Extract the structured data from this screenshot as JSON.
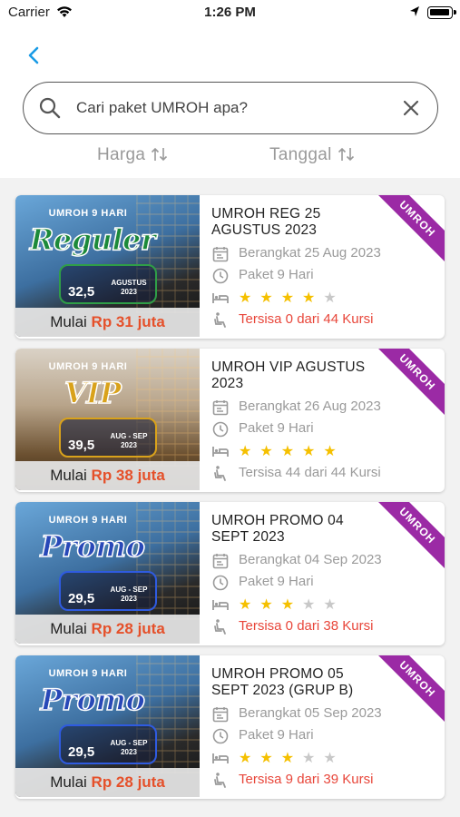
{
  "status_bar": {
    "carrier": "Carrier",
    "time": "1:26 PM"
  },
  "search": {
    "placeholder": "Cari paket UMROH apa?",
    "value": ""
  },
  "sort": {
    "price_label": "Harga",
    "date_label": "Tanggal"
  },
  "colors": {
    "accent": "#1a9be6",
    "ribbon": "#9b2aa5",
    "price": "#e5502a",
    "star": "#f5c000",
    "seats_warning": "#e8463a"
  },
  "packages": [
    {
      "thumb": {
        "tag": "UMROH 9 HARI",
        "script": "Reguler",
        "script_color": "#1c8a3a",
        "pill_color": "#2f9e47",
        "price": "32,5",
        "month": "AGUSTUS 2023",
        "bg": "linear-gradient(160deg,#6aa7d9 0%,#3d6fa0 45%,#2a2a2a 70%,#111 100%)"
      },
      "price_prefix": "Mulai",
      "price": "Rp 31 juta",
      "title": "UMROH REG 25 AGUSTUS 2023",
      "departure": "Berangkat 25 Aug 2023",
      "duration": "Paket 9 Hari",
      "rating": 4,
      "seats": "Tersisa 0 dari 44 Kursi",
      "seats_warning": true,
      "ribbon": "UMROH"
    },
    {
      "thumb": {
        "tag": "UMROH 9 HARI",
        "script": "VIP",
        "script_color": "#d9a21b",
        "pill_color": "#d9a21b",
        "price": "39,5",
        "month": "AUG - SEP 2023",
        "bg": "linear-gradient(180deg,#dad2c6 0%,#b8a48a 40%,#6b5030 75%,#3a2a18 100%)"
      },
      "price_prefix": "Mulai",
      "price": "Rp 38 juta",
      "title": "UMROH VIP AGUSTUS 2023",
      "departure": "Berangkat 26 Aug 2023",
      "duration": "Paket 9 Hari",
      "rating": 5,
      "seats": "Tersisa 44 dari 44 Kursi",
      "seats_warning": false,
      "ribbon": "UMROH"
    },
    {
      "thumb": {
        "tag": "UMROH 9 HARI",
        "script": "Promo",
        "script_color": "#2848b8",
        "pill_color": "#2f5be0",
        "price": "29,5",
        "month": "AUG - SEP 2023",
        "bg": "linear-gradient(160deg,#6aa7d9 0%,#3d6fa0 45%,#2a2a2a 70%,#111 100%)"
      },
      "price_prefix": "Mulai",
      "price": "Rp 28 juta",
      "title": "UMROH PROMO 04 SEPT 2023",
      "departure": "Berangkat 04 Sep 2023",
      "duration": "Paket 9 Hari",
      "rating": 3,
      "seats": "Tersisa 0 dari 38 Kursi",
      "seats_warning": true,
      "ribbon": "UMROH"
    },
    {
      "thumb": {
        "tag": "UMROH 9 HARI",
        "script": "Promo",
        "script_color": "#2848b8",
        "pill_color": "#2f5be0",
        "price": "29,5",
        "month": "AUG - SEP 2023",
        "bg": "linear-gradient(160deg,#6aa7d9 0%,#3d6fa0 45%,#2a2a2a 70%,#111 100%)"
      },
      "price_prefix": "Mulai",
      "price": "Rp 28 juta",
      "title": "UMROH PROMO 05 SEPT 2023 (GRUP B)",
      "departure": "Berangkat 05 Sep 2023",
      "duration": "Paket 9 Hari",
      "rating": 3,
      "seats": "Tersisa 9 dari 39 Kursi",
      "seats_warning": true,
      "ribbon": "UMROH"
    }
  ]
}
